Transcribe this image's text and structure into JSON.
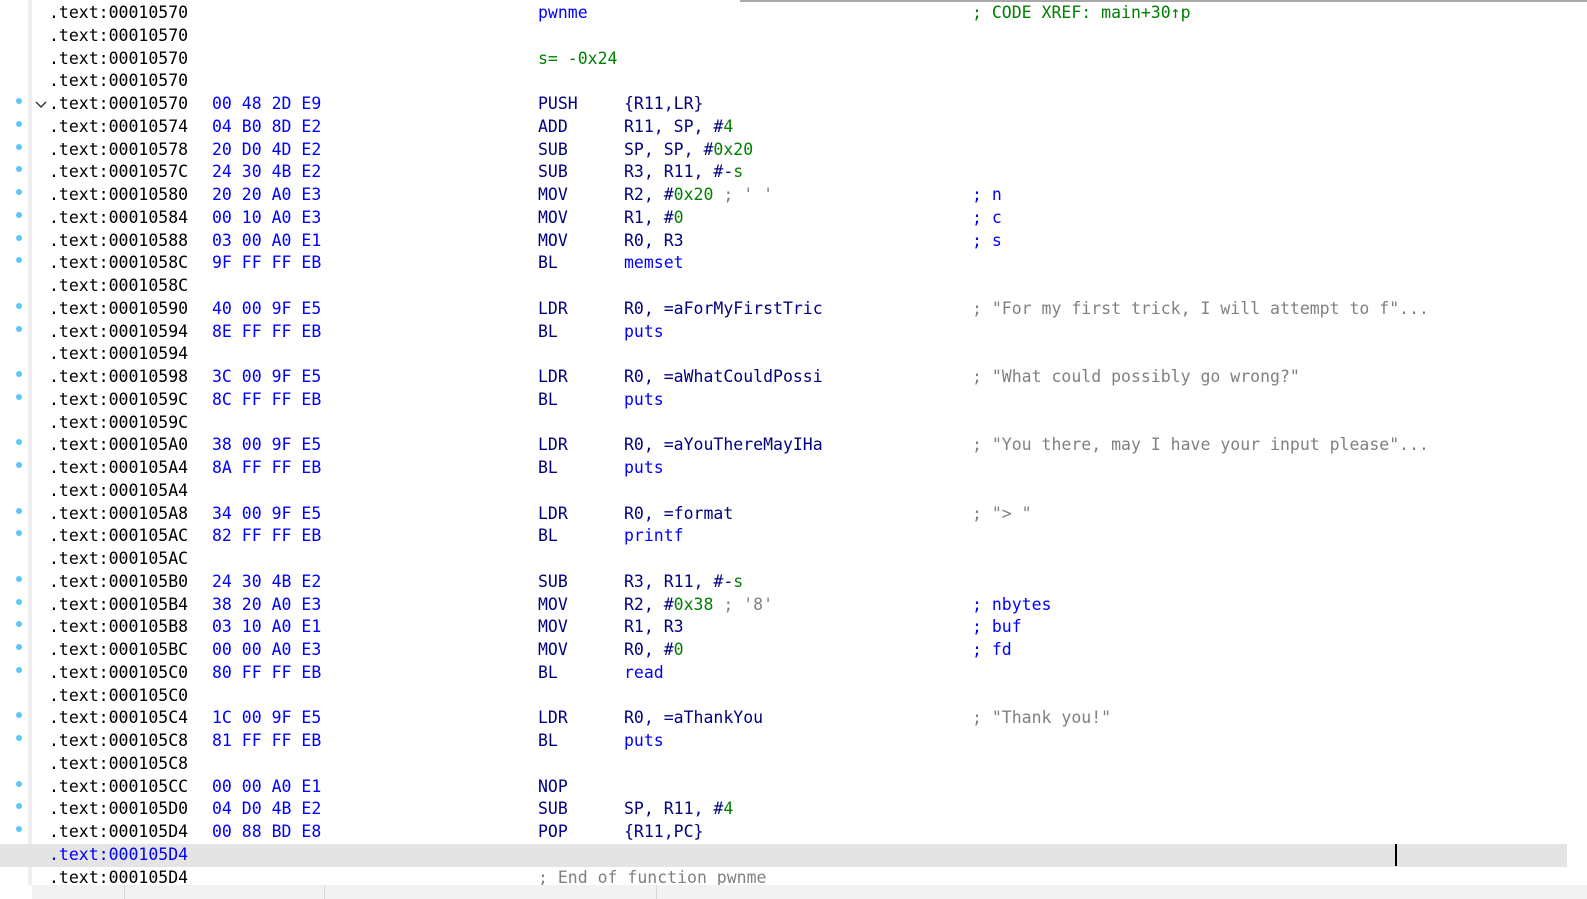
{
  "window": {
    "view": "IDA View - disassembly listing",
    "function": "pwnme"
  },
  "colors": {
    "address": "#000000",
    "bytes": "#0000ff",
    "mnemonic": "#000080",
    "number": "#008000",
    "symbol": "#0000ff",
    "comment": "#808080",
    "arg_comment": "#0000ff",
    "xref_comment": "#008000",
    "highlight_row": "#e4e4e4",
    "breakpoint_dot": "#5cc6f7"
  },
  "rows": [
    {
      "addr": ".text:00010570",
      "label": "pwnme",
      "cmt": "; CODE XREF: main+30↑p",
      "cmt_kind": "green"
    },
    {
      "addr": ".text:00010570"
    },
    {
      "addr": ".text:00010570",
      "label_green": "s= -0x24"
    },
    {
      "addr": ".text:00010570"
    },
    {
      "addr": ".text:00010570",
      "dot": true,
      "fold": true,
      "bytes": "00 48 2D E9",
      "mnem": "PUSH",
      "ops": [
        {
          "t": "{R11,LR}"
        }
      ]
    },
    {
      "addr": ".text:00010574",
      "dot": true,
      "bytes": "04 B0 8D E2",
      "mnem": "ADD",
      "ops": [
        {
          "t": "R11, SP, #"
        },
        {
          "t": "4",
          "c": "num"
        }
      ]
    },
    {
      "addr": ".text:00010578",
      "dot": true,
      "bytes": "20 D0 4D E2",
      "mnem": "SUB",
      "ops": [
        {
          "t": "SP, SP, #"
        },
        {
          "t": "0x20",
          "c": "num"
        }
      ]
    },
    {
      "addr": ".text:0001057C",
      "dot": true,
      "bytes": "24 30 4B E2",
      "mnem": "SUB",
      "ops": [
        {
          "t": "R3, R11, #-"
        },
        {
          "t": "s",
          "c": "num"
        }
      ]
    },
    {
      "addr": ".text:00010580",
      "dot": true,
      "bytes": "20 20 A0 E3",
      "mnem": "MOV",
      "ops": [
        {
          "t": "R2, #"
        },
        {
          "t": "0x20",
          "c": "num"
        },
        {
          "t": " ; ' '",
          "c": "icmt"
        }
      ],
      "cmt": "; n",
      "cmt_kind": "blue"
    },
    {
      "addr": ".text:00010584",
      "dot": true,
      "bytes": "00 10 A0 E3",
      "mnem": "MOV",
      "ops": [
        {
          "t": "R1, #"
        },
        {
          "t": "0",
          "c": "num"
        }
      ],
      "cmt": "; c",
      "cmt_kind": "blue"
    },
    {
      "addr": ".text:00010588",
      "dot": true,
      "bytes": "03 00 A0 E1",
      "mnem": "MOV",
      "ops": [
        {
          "t": "R0, R3"
        }
      ],
      "cmt": "; s",
      "cmt_kind": "blue"
    },
    {
      "addr": ".text:0001058C",
      "dot": true,
      "bytes": "9F FF FF EB",
      "mnem": "BL",
      "ops": [
        {
          "t": "memset",
          "c": "sym"
        }
      ]
    },
    {
      "addr": ".text:0001058C"
    },
    {
      "addr": ".text:00010590",
      "dot": true,
      "bytes": "40 00 9F E5",
      "mnem": "LDR",
      "ops": [
        {
          "t": "R0, =aForMyFirstTric"
        }
      ],
      "cmt": "; \"For my first trick, I will attempt to f\"...",
      "cmt_kind": "gray"
    },
    {
      "addr": ".text:00010594",
      "dot": true,
      "bytes": "8E FF FF EB",
      "mnem": "BL",
      "ops": [
        {
          "t": "puts",
          "c": "sym"
        }
      ]
    },
    {
      "addr": ".text:00010594"
    },
    {
      "addr": ".text:00010598",
      "dot": true,
      "bytes": "3C 00 9F E5",
      "mnem": "LDR",
      "ops": [
        {
          "t": "R0, =aWhatCouldPossi"
        }
      ],
      "cmt": "; \"What could possibly go wrong?\"",
      "cmt_kind": "gray"
    },
    {
      "addr": ".text:0001059C",
      "dot": true,
      "bytes": "8C FF FF EB",
      "mnem": "BL",
      "ops": [
        {
          "t": "puts",
          "c": "sym"
        }
      ]
    },
    {
      "addr": ".text:0001059C"
    },
    {
      "addr": ".text:000105A0",
      "dot": true,
      "bytes": "38 00 9F E5",
      "mnem": "LDR",
      "ops": [
        {
          "t": "R0, =aYouThereMayIHa"
        }
      ],
      "cmt": "; \"You there, may I have your input please\"...",
      "cmt_kind": "gray"
    },
    {
      "addr": ".text:000105A4",
      "dot": true,
      "bytes": "8A FF FF EB",
      "mnem": "BL",
      "ops": [
        {
          "t": "puts",
          "c": "sym"
        }
      ]
    },
    {
      "addr": ".text:000105A4"
    },
    {
      "addr": ".text:000105A8",
      "dot": true,
      "bytes": "34 00 9F E5",
      "mnem": "LDR",
      "ops": [
        {
          "t": "R0, =format"
        }
      ],
      "cmt": "; \"> \"",
      "cmt_kind": "gray"
    },
    {
      "addr": ".text:000105AC",
      "dot": true,
      "bytes": "82 FF FF EB",
      "mnem": "BL",
      "ops": [
        {
          "t": "printf",
          "c": "sym"
        }
      ]
    },
    {
      "addr": ".text:000105AC"
    },
    {
      "addr": ".text:000105B0",
      "dot": true,
      "bytes": "24 30 4B E2",
      "mnem": "SUB",
      "ops": [
        {
          "t": "R3, R11, #-"
        },
        {
          "t": "s",
          "c": "num"
        }
      ]
    },
    {
      "addr": ".text:000105B4",
      "dot": true,
      "bytes": "38 20 A0 E3",
      "mnem": "MOV",
      "ops": [
        {
          "t": "R2, #"
        },
        {
          "t": "0x38",
          "c": "num"
        },
        {
          "t": " ; '8'",
          "c": "icmt"
        }
      ],
      "cmt": "; nbytes",
      "cmt_kind": "blue"
    },
    {
      "addr": ".text:000105B8",
      "dot": true,
      "bytes": "03 10 A0 E1",
      "mnem": "MOV",
      "ops": [
        {
          "t": "R1, R3"
        }
      ],
      "cmt": "; buf",
      "cmt_kind": "blue"
    },
    {
      "addr": ".text:000105BC",
      "dot": true,
      "bytes": "00 00 A0 E3",
      "mnem": "MOV",
      "ops": [
        {
          "t": "R0, #"
        },
        {
          "t": "0",
          "c": "num"
        }
      ],
      "cmt": "; fd",
      "cmt_kind": "blue"
    },
    {
      "addr": ".text:000105C0",
      "dot": true,
      "bytes": "80 FF FF EB",
      "mnem": "BL",
      "ops": [
        {
          "t": "read",
          "c": "sym"
        }
      ]
    },
    {
      "addr": ".text:000105C0"
    },
    {
      "addr": ".text:000105C4",
      "dot": true,
      "bytes": "1C 00 9F E5",
      "mnem": "LDR",
      "ops": [
        {
          "t": "R0, =aThankYou"
        }
      ],
      "cmt": "; \"Thank you!\"",
      "cmt_kind": "gray"
    },
    {
      "addr": ".text:000105C8",
      "dot": true,
      "bytes": "81 FF FF EB",
      "mnem": "BL",
      "ops": [
        {
          "t": "puts",
          "c": "sym"
        }
      ]
    },
    {
      "addr": ".text:000105C8"
    },
    {
      "addr": ".text:000105CC",
      "dot": true,
      "bytes": "00 00 A0 E1",
      "mnem": "NOP"
    },
    {
      "addr": ".text:000105D0",
      "dot": true,
      "bytes": "04 D0 4B E2",
      "mnem": "SUB",
      "ops": [
        {
          "t": "SP, R11, #"
        },
        {
          "t": "4",
          "c": "num"
        }
      ]
    },
    {
      "addr": ".text:000105D4",
      "dot": true,
      "bytes": "00 88 BD E8",
      "mnem": "POP",
      "ops": [
        {
          "t": "{R11,PC}"
        }
      ]
    },
    {
      "addr": ".text:000105D4",
      "highlight": true,
      "caret": true
    },
    {
      "addr": ".text:000105D4",
      "end_cmt": "; End of function pwnme"
    }
  ]
}
